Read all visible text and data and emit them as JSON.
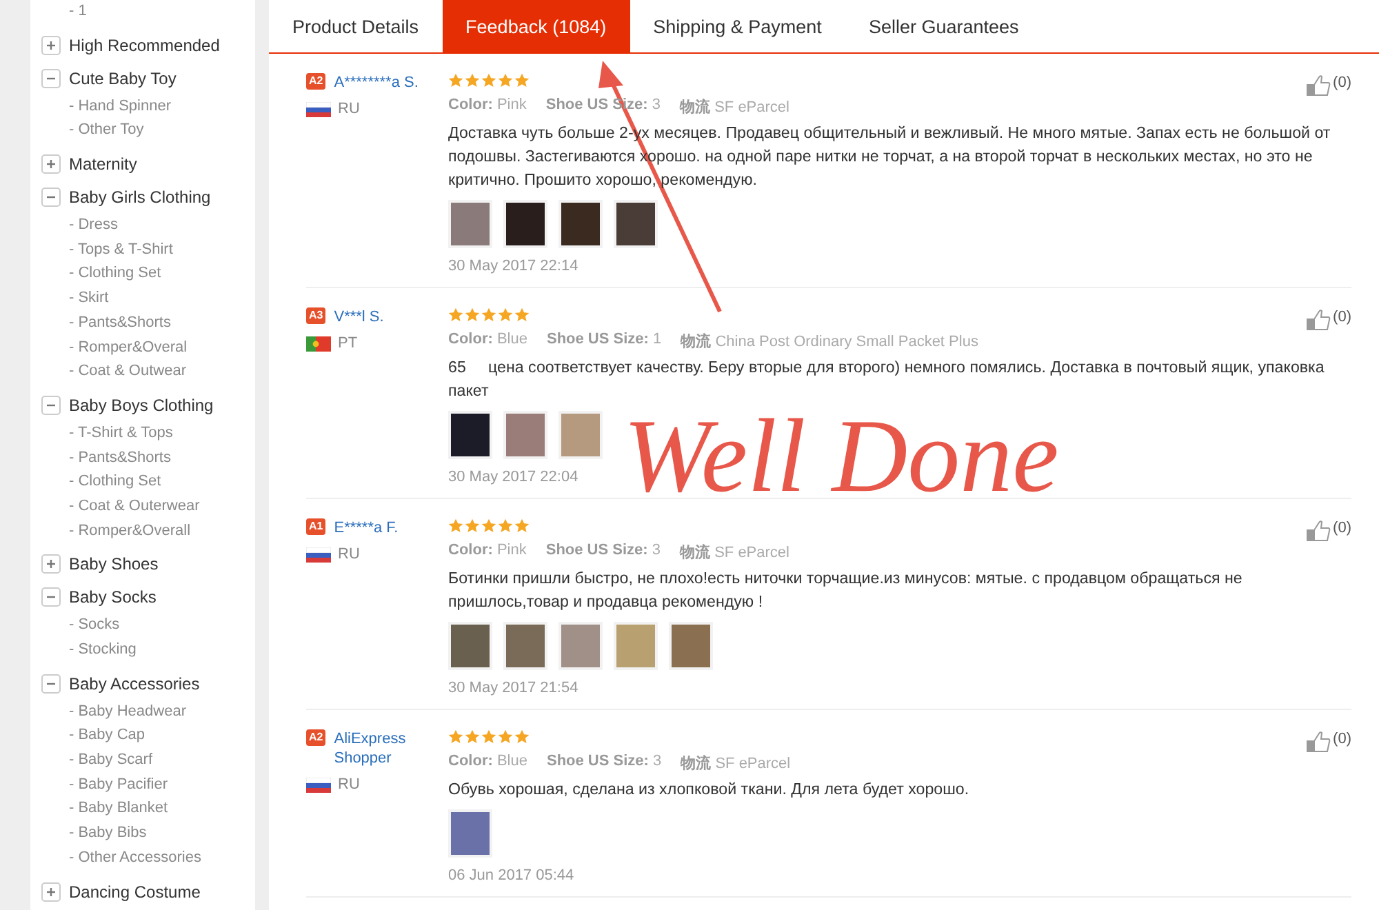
{
  "sidebar": {
    "partial_items": [
      "- 1"
    ],
    "categories": [
      {
        "label": "High Recommended",
        "expanded": false
      },
      {
        "label": "Cute Baby Toy",
        "expanded": true,
        "children": [
          "- Hand Spinner",
          "- Other Toy"
        ]
      },
      {
        "label": "Maternity",
        "expanded": false
      },
      {
        "label": "Baby Girls Clothing",
        "expanded": true,
        "children": [
          "- Dress",
          "- Tops & T-Shirt",
          "- Clothing Set",
          "- Skirt",
          "- Pants&Shorts",
          "- Romper&Overal",
          "- Coat & Outwear"
        ]
      },
      {
        "label": "Baby Boys Clothing",
        "expanded": true,
        "children": [
          "- T-Shirt & Tops",
          "- Pants&Shorts",
          "- Clothing Set",
          "- Coat & Outerwear",
          "- Romper&Overall"
        ]
      },
      {
        "label": "Baby Shoes",
        "expanded": false
      },
      {
        "label": "Baby Socks",
        "expanded": true,
        "children": [
          "- Socks",
          "- Stocking"
        ]
      },
      {
        "label": "Baby Accessories",
        "expanded": true,
        "children": [
          "- Baby Headwear",
          "- Baby Cap",
          "- Baby Scarf",
          "- Baby Pacifier",
          "- Baby Blanket",
          "- Baby Bibs",
          "- Other Accessories"
        ]
      },
      {
        "label": "Dancing Costume",
        "expanded": false
      }
    ]
  },
  "tabs": [
    {
      "label": "Product Details",
      "selected": false
    },
    {
      "label": "Feedback (1084)",
      "selected": true
    },
    {
      "label": "Shipping & Payment",
      "selected": false
    },
    {
      "label": "Seller Guarantees",
      "selected": false
    }
  ],
  "reviews": [
    {
      "level_badge": "A2",
      "name": "A********a S.",
      "country": "RU",
      "flag": {
        "kind": "stripes"
      },
      "stars": 5,
      "meta": [
        {
          "label": "Color:",
          "value": "Pink"
        },
        {
          "label": "Shoe US Size:",
          "value": "3"
        },
        {
          "label": "物流",
          "value": "SF eParcel"
        }
      ],
      "text": "Доставка чуть больше 2-ух месяцев. Продавец общительный и вежливый. Не много мятые. Запах есть не большой от подошвы. Застегиваются хорошо. на одной паре нитки не торчат, а на второй торчат в нескольких местах, но это не критично. Прошито хорошо, рекомендую.",
      "photos": [
        {
          "kind": "photo",
          "color": "#8a7a7a"
        },
        {
          "kind": "photo",
          "color": "#2a1e1c"
        },
        {
          "kind": "photo",
          "color": "#3a2a20"
        },
        {
          "kind": "photo",
          "color": "#4a3c36"
        }
      ],
      "date": "30 May 2017 22:14",
      "likes": "(0)"
    },
    {
      "level_badge": "A3",
      "name": "V***l S.",
      "country": "PT",
      "flag": {
        "kind": "split"
      },
      "stars": 5,
      "meta": [
        {
          "label": "Color:",
          "value": "Blue"
        },
        {
          "label": "Shoe US Size:",
          "value": "1"
        },
        {
          "label": "物流",
          "value": "China Post Ordinary Small Packet Plus"
        }
      ],
      "text": "65     цена соответствует качеству. Беру вторые для второго) немного помялись. Доставка в почтовый ящик, упаковка пакет",
      "photos": [
        {
          "kind": "photo",
          "color": "#1c1c28"
        },
        {
          "kind": "photo",
          "color": "#9a7c78"
        },
        {
          "kind": "photo",
          "color": "#b59a80"
        }
      ],
      "date": "30 May 2017 22:04",
      "likes": "(0)"
    },
    {
      "level_badge": "A1",
      "name": "E*****a F.",
      "country": "RU",
      "flag": {
        "kind": "stripes"
      },
      "stars": 5,
      "meta": [
        {
          "label": "Color:",
          "value": "Pink"
        },
        {
          "label": "Shoe US Size:",
          "value": "3"
        },
        {
          "label": "物流",
          "value": "SF eParcel"
        }
      ],
      "text": "Ботинки пришли быстро, не плохо!есть ниточки торчащие.из минусов: мятые. с продавцом обращаться не пришлось,товар и продавца рекомендую !",
      "photos": [
        {
          "kind": "photo",
          "color": "#6a6050"
        },
        {
          "kind": "photo",
          "color": "#7a6a58"
        },
        {
          "kind": "photo",
          "color": "#a09088"
        },
        {
          "kind": "photo",
          "color": "#b8a070"
        },
        {
          "kind": "photo",
          "color": "#8a7050"
        }
      ],
      "date": "30 May 2017 21:54",
      "likes": "(0)"
    },
    {
      "level_badge": "A2",
      "name": "AliExpress Shopper",
      "country": "RU",
      "flag": {
        "kind": "stripes"
      },
      "stars": 5,
      "meta": [
        {
          "label": "Color:",
          "value": "Blue"
        },
        {
          "label": "Shoe US Size:",
          "value": "3"
        },
        {
          "label": "物流",
          "value": "SF eParcel"
        }
      ],
      "text": "Обувь хорошая, сделана из хлопковой ткани. Для лета будет хорошо.",
      "photos": [
        {
          "kind": "photo",
          "color": "#6a70a8"
        }
      ],
      "date": "06 Jun 2017 05:44",
      "likes": "(0)"
    }
  ],
  "annotation": {
    "handwriting": "Well Done"
  }
}
